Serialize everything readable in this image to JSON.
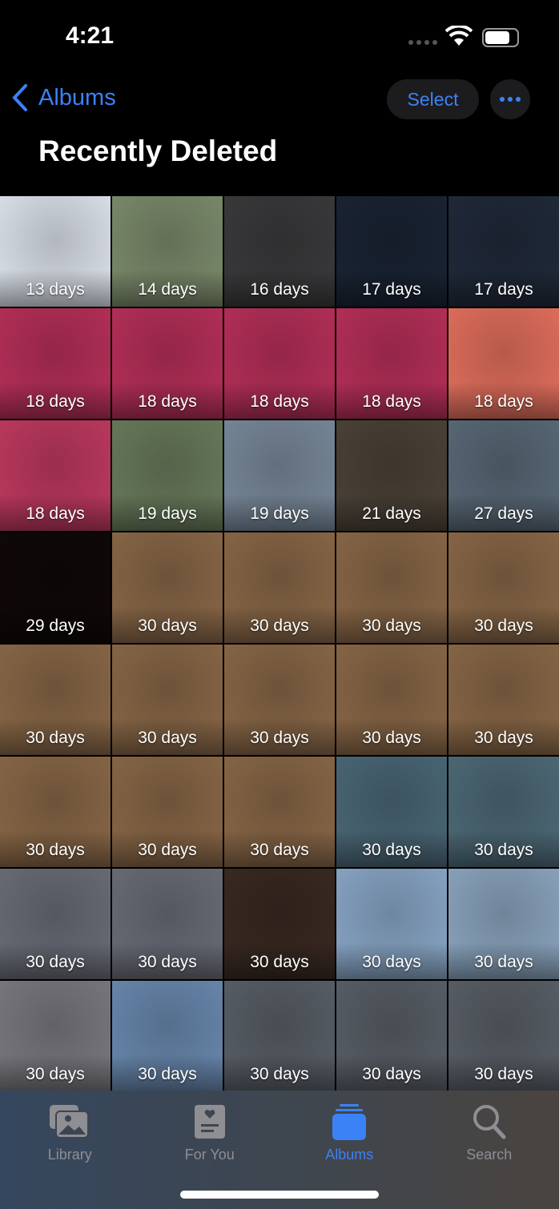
{
  "status": {
    "time": "4:21"
  },
  "nav": {
    "back_label": "Albums",
    "select_label": "Select",
    "title": "Recently Deleted"
  },
  "tiles": [
    {
      "label": "13 days",
      "color": "#dfe5ee"
    },
    {
      "label": "14 days",
      "color": "#7d8c6c"
    },
    {
      "label": "16 days",
      "color": "#3b3a3c"
    },
    {
      "label": "17 days",
      "color": "#1a2434"
    },
    {
      "label": "17 days",
      "color": "#202a3a"
    },
    {
      "label": "18 days",
      "color": "#b8305a"
    },
    {
      "label": "18 days",
      "color": "#b8305a"
    },
    {
      "label": "18 days",
      "color": "#b8305a"
    },
    {
      "label": "18 days",
      "color": "#b8305a"
    },
    {
      "label": "18 days",
      "color": "#e4705e"
    },
    {
      "label": "18 days",
      "color": "#c03a60"
    },
    {
      "label": "19 days",
      "color": "#6a7c5c"
    },
    {
      "label": "19 days",
      "color": "#7a8a9c"
    },
    {
      "label": "21 days",
      "color": "#4c4338"
    },
    {
      "label": "27 days",
      "color": "#5a6a78"
    },
    {
      "label": "29 days",
      "color": "#100808"
    },
    {
      "label": "30 days",
      "color": "#8a6848"
    },
    {
      "label": "30 days",
      "color": "#8a6848"
    },
    {
      "label": "30 days",
      "color": "#8a6848"
    },
    {
      "label": "30 days",
      "color": "#8a6848"
    },
    {
      "label": "30 days",
      "color": "#8a6848"
    },
    {
      "label": "30 days",
      "color": "#8a6848"
    },
    {
      "label": "30 days",
      "color": "#8a6848"
    },
    {
      "label": "30 days",
      "color": "#8a6848"
    },
    {
      "label": "30 days",
      "color": "#8a6848"
    },
    {
      "label": "30 days",
      "color": "#8a6848"
    },
    {
      "label": "30 days",
      "color": "#8a6848"
    },
    {
      "label": "30 days",
      "color": "#8a6848"
    },
    {
      "label": "30 days",
      "color": "#4b6878"
    },
    {
      "label": "30 days",
      "color": "#4e6a78"
    },
    {
      "label": "30 days",
      "color": "#6a6e78"
    },
    {
      "label": "30 days",
      "color": "#6a6e78"
    },
    {
      "label": "30 days",
      "color": "#3a2a22"
    },
    {
      "label": "30 days",
      "color": "#8aa8c8"
    },
    {
      "label": "30 days",
      "color": "#8ca6c0"
    },
    {
      "label": "30 days",
      "color": "#7a7a80"
    },
    {
      "label": "30 days",
      "color": "#6a8ab0"
    },
    {
      "label": "30 days",
      "color": "#5a6068"
    },
    {
      "label": "30 days",
      "color": "#5a6068"
    },
    {
      "label": "30 days",
      "color": "#5a6068"
    }
  ],
  "tabs": [
    {
      "label": "Library",
      "icon": "photos-stack-icon"
    },
    {
      "label": "For You",
      "icon": "memories-card-icon"
    },
    {
      "label": "Albums",
      "icon": "albums-icon",
      "active": true
    },
    {
      "label": "Search",
      "icon": "search-icon"
    }
  ],
  "colors": {
    "accent": "#3b82f6"
  }
}
